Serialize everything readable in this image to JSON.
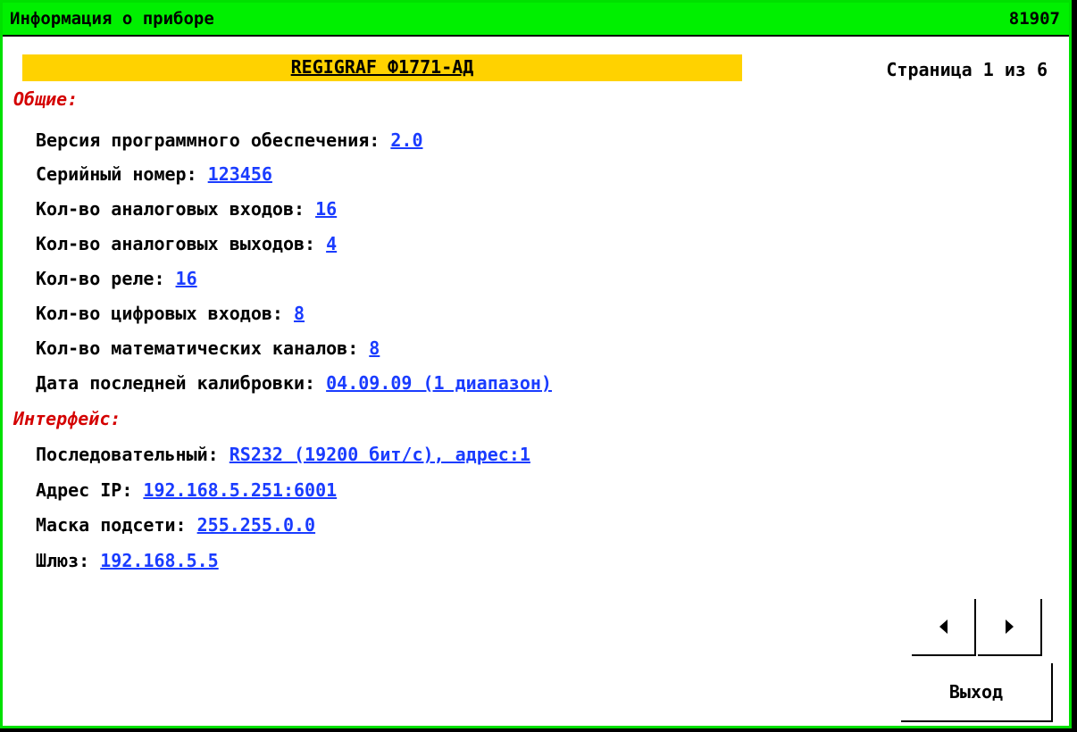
{
  "titlebar": {
    "title": "Информация о приборе",
    "code": "81907"
  },
  "device": {
    "name": "REGIGRAF Ф1771-АД"
  },
  "pagination": {
    "label": "Страница 1 из 6"
  },
  "sections": {
    "general": {
      "heading": "Общие:",
      "fields": [
        {
          "label": "Версия программного обеспечения: ",
          "value": "2.0"
        },
        {
          "label": "Серийный номер: ",
          "value": "123456"
        },
        {
          "label": "Кол-во аналоговых входов: ",
          "value": "16"
        },
        {
          "label": "Кол-во аналоговых выходов: ",
          "value": "4"
        },
        {
          "label": "Кол-во реле: ",
          "value": "16"
        },
        {
          "label": "Кол-во цифровых входов: ",
          "value": "8"
        },
        {
          "label": "Кол-во математических каналов: ",
          "value": "8"
        },
        {
          "label": "Дата последней калибровки: ",
          "value": "04.09.09 (1 диапазон)"
        }
      ]
    },
    "interface": {
      "heading": "Интерфейс:",
      "fields": [
        {
          "label": "Последовательный: ",
          "value": "RS232 (19200 бит/с), адрес:1"
        },
        {
          "label": "Адрес IP: ",
          "value": "192.168.5.251:6001"
        },
        {
          "label": "Маска подсети: ",
          "value": "255.255.0.0"
        },
        {
          "label": "Шлюз: ",
          "value": "192.168.5.5"
        }
      ]
    }
  },
  "buttons": {
    "prev_icon": "arrow-left-icon",
    "next_icon": "arrow-right-icon",
    "exit_label": "Выход"
  },
  "colors": {
    "titlebar": "#00f000",
    "frame_border": "#00e000",
    "banner": "#ffd200",
    "section_heading": "#d40000",
    "link_value": "#1a3cff"
  }
}
